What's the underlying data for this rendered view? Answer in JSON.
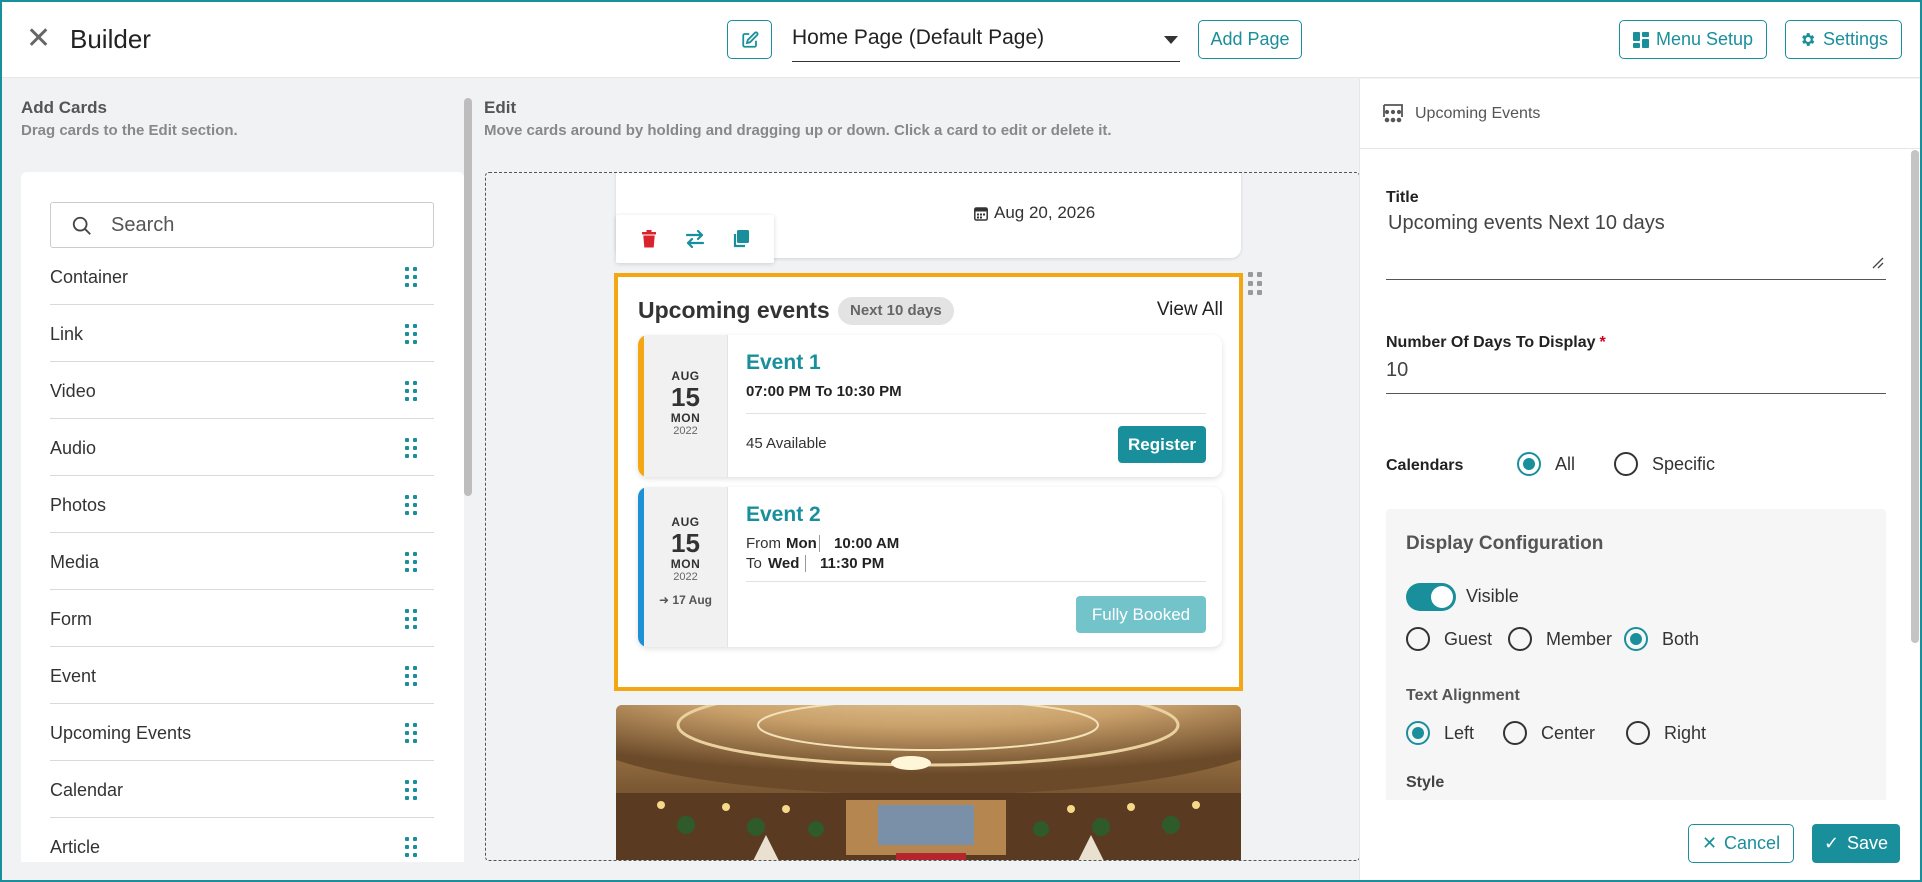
{
  "header": {
    "close_icon": "close-icon",
    "title": "Builder",
    "page_select_value": "Home Page (Default Page)",
    "add_page_label": "Add Page",
    "menu_setup_label": "Menu Setup",
    "settings_label": "Settings",
    "accent_color": "#1a8f9c"
  },
  "left": {
    "title": "Add Cards",
    "subtitle": "Drag cards to the Edit section.",
    "search_placeholder": "Search",
    "cards": [
      "Container",
      "Link",
      "Video",
      "Audio",
      "Photos",
      "Media",
      "Form",
      "Event",
      "Upcoming Events",
      "Calendar",
      "Article"
    ]
  },
  "edit": {
    "title": "Edit",
    "subtitle": "Move cards around by holding and dragging up or down. Click a card to edit or delete it.",
    "prev_card_date": "Aug 20, 2026",
    "upcoming": {
      "title": "Upcoming events",
      "badge": "Next 10 days",
      "view_all": "View All",
      "border_color": "#f3a712",
      "events": [
        {
          "name": "Event 1",
          "month": "AUG",
          "day": "15",
          "weekday": "MON",
          "year": "2022",
          "time": "07:00 PM To 10:30 PM",
          "available": "45 Available",
          "button": "Register",
          "stripe_color": "#f3a712"
        },
        {
          "name": "Event 2",
          "month": "AUG",
          "day": "15",
          "weekday": "MON",
          "year": "2022",
          "end_date": "17 Aug",
          "from_prefix": "From",
          "from_day": "Mon",
          "from_time": "10:00 AM",
          "to_prefix": "To",
          "to_day": "Wed",
          "to_time": "11:30 PM",
          "button": "Fully Booked",
          "stripe_color": "#1e90d6"
        }
      ]
    }
  },
  "right": {
    "header_label": "Upcoming Events",
    "title_label": "Title",
    "title_value": "Upcoming events Next 10 days",
    "days_label": "Number Of Days To Display",
    "days_required": "*",
    "days_value": "10",
    "calendars_label": "Calendars",
    "calendars_options": [
      "All",
      "Specific"
    ],
    "calendars_selected": "All",
    "display_config": {
      "title": "Display Configuration",
      "visible_label": "Visible",
      "visible": true,
      "audience_options": [
        "Guest",
        "Member",
        "Both"
      ],
      "audience_selected": "Both",
      "text_alignment_label": "Text Alignment",
      "alignment_options": [
        "Left",
        "Center",
        "Right"
      ],
      "alignment_selected": "Left",
      "style_label": "Style"
    },
    "cancel_label": "Cancel",
    "save_label": "Save"
  }
}
